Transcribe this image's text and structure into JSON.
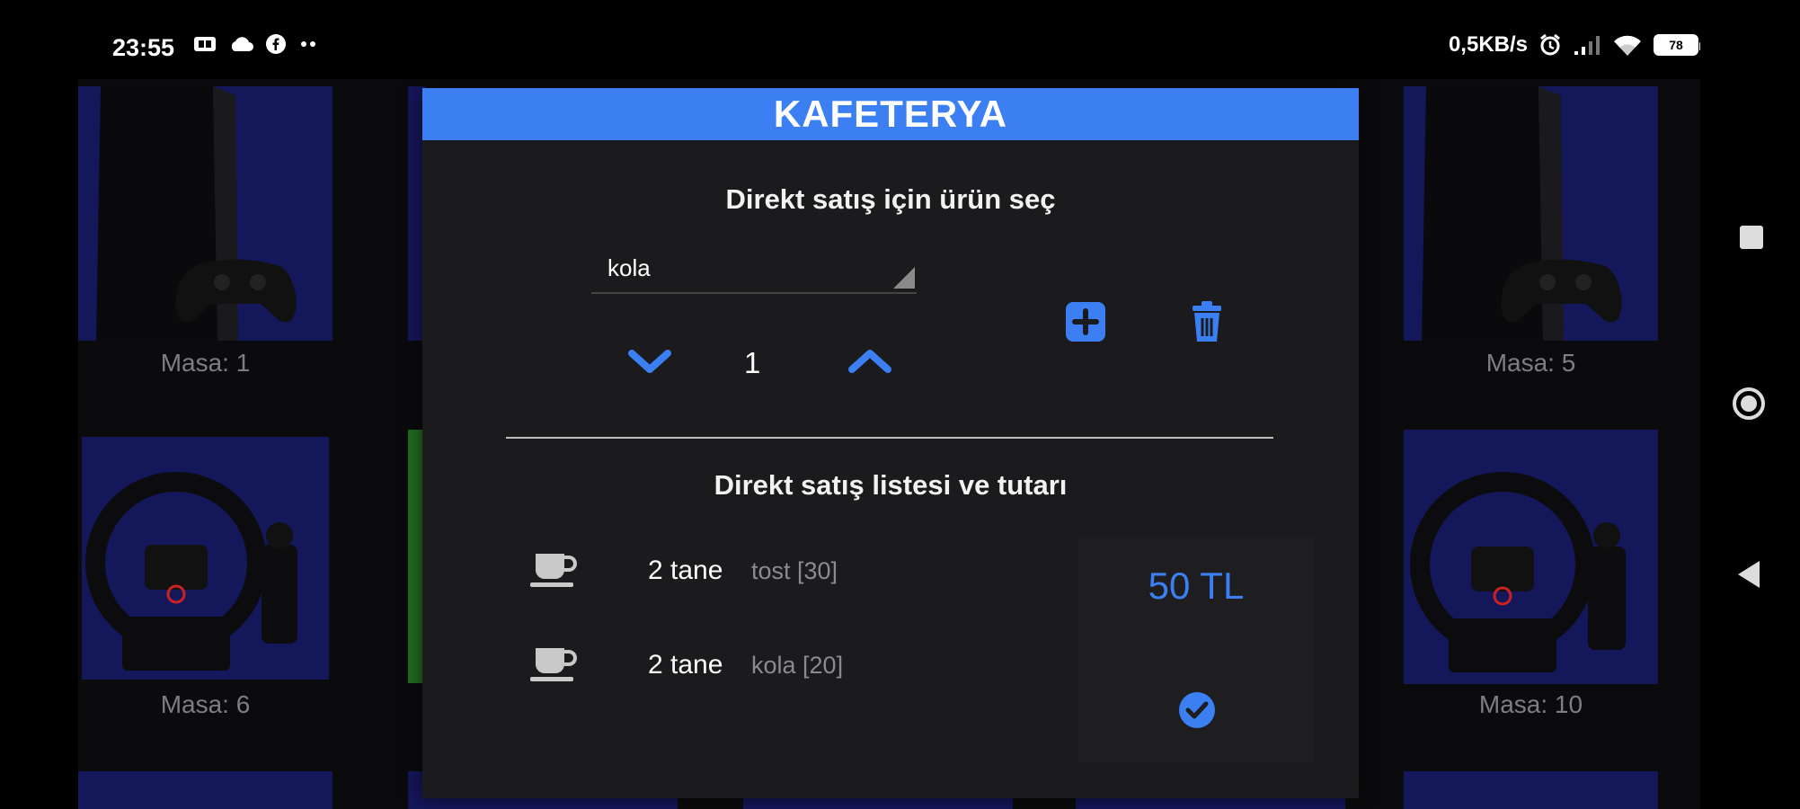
{
  "status_bar": {
    "time": "23:55",
    "speed": "0,5KB/s",
    "battery": "78"
  },
  "tiles": [
    {
      "label": "Masa: 1",
      "device": "ps4"
    },
    {
      "label": "Masa: 5",
      "device": "ps4"
    },
    {
      "label": "Masa: 6",
      "device": "steering-wheel"
    },
    {
      "label": "Masa: 10",
      "device": "steering-wheel"
    }
  ],
  "dialog": {
    "title": "KAFETERYA",
    "select_section_title": "Direkt satış için ürün seç",
    "product_select": {
      "value": "kola"
    },
    "quantity": "1",
    "list_section_title": "Direkt satış listesi ve tutarı",
    "items": [
      {
        "count": "2 tane",
        "desc": "tost [30]"
      },
      {
        "count": "2 tane",
        "desc": "kola [20]"
      }
    ],
    "total": "50 TL"
  },
  "colors": {
    "accent": "#3b7ff2",
    "tile_bg": "#14175a",
    "dialog_bg": "#1b1b1d",
    "green_strip": "#1f6b1f"
  },
  "icons": {
    "add": "plus-square-icon",
    "delete": "trash-icon",
    "decrement": "chevron-down-icon",
    "increment": "chevron-up-icon",
    "item": "coffee-cup-icon",
    "confirm": "check-circle-icon"
  }
}
